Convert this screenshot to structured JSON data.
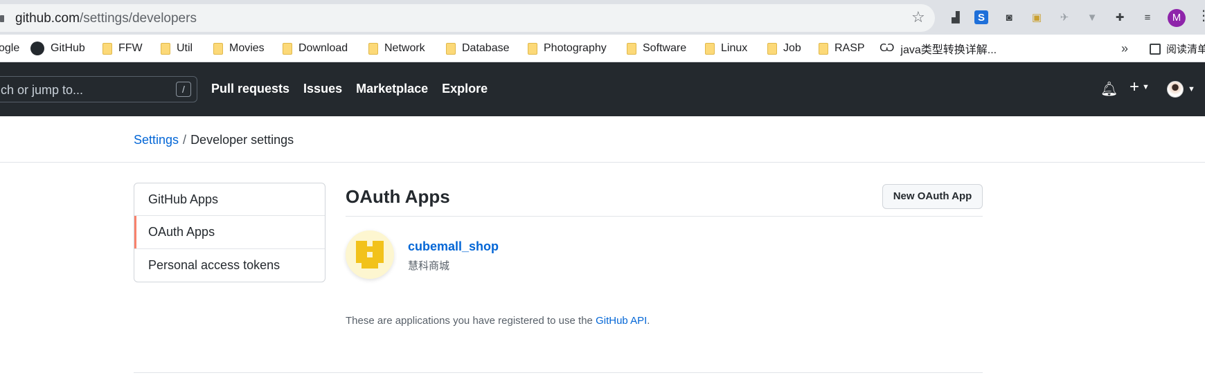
{
  "browser": {
    "url_host": "github.com",
    "url_path": "/settings/developers",
    "profile_initial": "M",
    "colors": {
      "profile": "#8e24aa"
    },
    "bookmarks": [
      {
        "label": "ogle",
        "icon": "google-icon"
      },
      {
        "label": "GitHub",
        "icon": "github-icon"
      },
      {
        "label": "FFW",
        "icon": "folder-icon"
      },
      {
        "label": "Util",
        "icon": "folder-icon"
      },
      {
        "label": "Movies",
        "icon": "folder-icon"
      },
      {
        "label": "Download",
        "icon": "folder-icon"
      },
      {
        "label": "Network",
        "icon": "folder-icon"
      },
      {
        "label": "Database",
        "icon": "folder-icon"
      },
      {
        "label": "Photography",
        "icon": "folder-icon"
      },
      {
        "label": "Software",
        "icon": "folder-icon"
      },
      {
        "label": "Linux",
        "icon": "folder-icon"
      },
      {
        "label": "Job",
        "icon": "folder-icon"
      },
      {
        "label": "RASP",
        "icon": "folder-icon"
      },
      {
        "label": "java类型转换详解...",
        "icon": "link-icon"
      }
    ],
    "more_bookmarks": "»",
    "reading_list": "阅读清单"
  },
  "header": {
    "search_placeholder": "ch or jump to...",
    "search_shortcut": "/",
    "nav": [
      "Pull requests",
      "Issues",
      "Marketplace",
      "Explore"
    ],
    "plus": "+"
  },
  "breadcrumb": {
    "parent": "Settings",
    "separator": "/",
    "current": "Developer settings"
  },
  "sidebar": {
    "items": [
      {
        "label": "GitHub Apps",
        "selected": false
      },
      {
        "label": "OAuth Apps",
        "selected": true
      },
      {
        "label": "Personal access tokens",
        "selected": false
      }
    ]
  },
  "main": {
    "title": "OAuth Apps",
    "new_button": "New OAuth App",
    "apps": [
      {
        "name": "cubemall_shop",
        "description": "慧科商城"
      }
    ],
    "note_prefix": "These are applications you have registered to use the ",
    "note_link": "GitHub API",
    "note_suffix": "."
  },
  "colors": {
    "accent": "#0366d6",
    "header_bg": "#24292e",
    "selected_marker": "#f9826c",
    "app_logo": "#f2c21b"
  }
}
